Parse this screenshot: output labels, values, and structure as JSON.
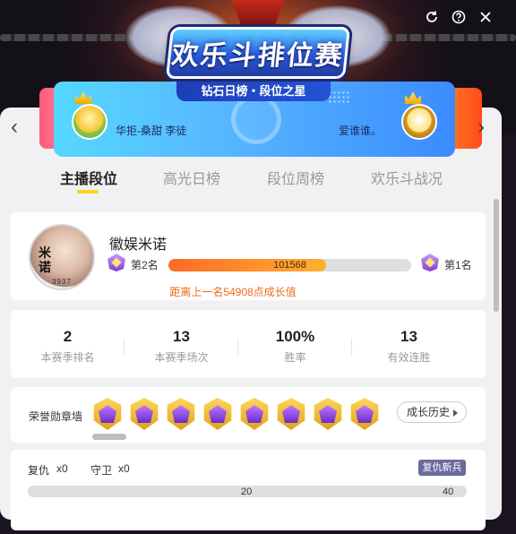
{
  "window_buttons": {
    "refresh": "refresh-icon",
    "help": "help-icon",
    "close": "close-icon"
  },
  "event_logo": "欢乐斗排位赛",
  "banner": {
    "title": "钻石日榜・段位之星",
    "left_name": "华拒-桑甜 李徒",
    "right_name": "爱谁谁。"
  },
  "tabs": [
    {
      "label": "主播段位",
      "active": true
    },
    {
      "label": "高光日榜",
      "active": false
    },
    {
      "label": "段位周榜",
      "active": false
    },
    {
      "label": "欢乐斗战况",
      "active": false
    }
  ],
  "profile": {
    "name": "徽娱米诺",
    "avatar_sig": "米诺",
    "avatar_num": "3937",
    "current_rank": "第2名",
    "next_rank": "第1名",
    "score_display": "101568",
    "progress": 0.65,
    "gap_text": "距离上一名54908点成长值",
    "accent_color": "#ef6a1a"
  },
  "stats": [
    {
      "value": "2",
      "label": "本赛季排名"
    },
    {
      "value": "13",
      "label": "本赛季场次"
    },
    {
      "value": "100%",
      "label": "胜率"
    },
    {
      "value": "13",
      "label": "有效连胜"
    }
  ],
  "honor": {
    "label": "荣誉勋章墙",
    "badge_count": 8,
    "history_button": "成长历史"
  },
  "revenge": {
    "revenge_label": "复仇",
    "revenge_count": "x0",
    "guard_label": "守卫",
    "guard_count": "x0",
    "tag": "复仇新兵",
    "bar_mid": "20",
    "bar_max": "40"
  }
}
